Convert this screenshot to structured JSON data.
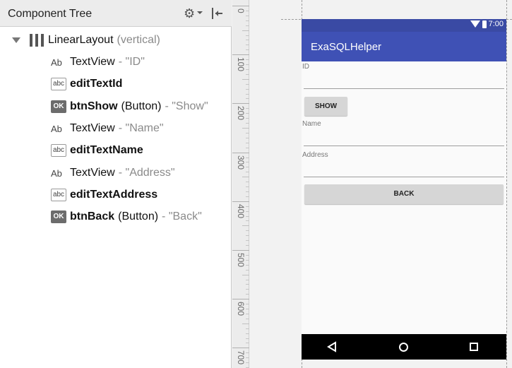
{
  "component_tree": {
    "title": "Component Tree",
    "root": {
      "name": "LinearLayout",
      "detail": "(vertical)"
    },
    "items": [
      {
        "icon": "textview-icon",
        "name": "TextView",
        "type": "",
        "text": "- \"ID\"",
        "bold": false
      },
      {
        "icon": "edittext-icon",
        "name": "editTextId",
        "type": "",
        "text": "",
        "bold": true
      },
      {
        "icon": "button-icon",
        "name": "btnShow",
        "type": "(Button)",
        "text": "- \"Show\"",
        "bold": true
      },
      {
        "icon": "textview-icon",
        "name": "TextView",
        "type": "",
        "text": "- \"Name\"",
        "bold": false
      },
      {
        "icon": "edittext-icon",
        "name": "editTextName",
        "type": "",
        "text": "",
        "bold": true
      },
      {
        "icon": "textview-icon",
        "name": "TextView",
        "type": "",
        "text": "- \"Address\"",
        "bold": false
      },
      {
        "icon": "edittext-icon",
        "name": "editTextAddress",
        "type": "",
        "text": "",
        "bold": true
      },
      {
        "icon": "button-icon",
        "name": "btnBack",
        "type": "(Button)",
        "text": "- \"Back\"",
        "bold": true
      }
    ],
    "icon_text": {
      "textview": "Ab",
      "edittext": "abc",
      "button": "OK"
    }
  },
  "ruler": {
    "labels": [
      "0",
      "100",
      "200",
      "300",
      "400",
      "500",
      "600",
      "700"
    ]
  },
  "phone": {
    "status_time": "7:00",
    "app_title": "ExaSQLHelper",
    "label_id": "ID",
    "show_button": "SHOW",
    "label_name": "Name",
    "label_address": "Address",
    "back_button": "BACK"
  },
  "colors": {
    "primary": "#3f51b5",
    "primary_dark": "#3a4aa4"
  }
}
